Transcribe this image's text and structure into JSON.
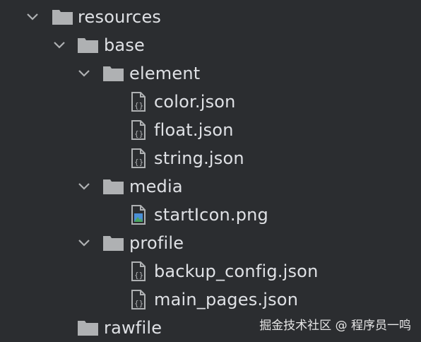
{
  "tree": {
    "items": [
      {
        "label": "resources",
        "type": "folder",
        "expanded": true,
        "icon": "folder-icon"
      },
      {
        "label": "base",
        "type": "folder",
        "expanded": true,
        "icon": "folder-icon"
      },
      {
        "label": "element",
        "type": "folder",
        "expanded": true,
        "icon": "folder-icon"
      },
      {
        "label": "color.json",
        "type": "file",
        "icon": "json-file-icon"
      },
      {
        "label": "float.json",
        "type": "file",
        "icon": "json-file-icon"
      },
      {
        "label": "string.json",
        "type": "file",
        "icon": "json-file-icon"
      },
      {
        "label": "media",
        "type": "folder",
        "expanded": true,
        "icon": "folder-icon"
      },
      {
        "label": "startIcon.png",
        "type": "file",
        "icon": "image-file-icon"
      },
      {
        "label": "profile",
        "type": "folder",
        "expanded": true,
        "icon": "folder-icon"
      },
      {
        "label": "backup_config.json",
        "type": "file",
        "icon": "json-file-icon"
      },
      {
        "label": "main_pages.json",
        "type": "file",
        "icon": "json-file-icon"
      },
      {
        "label": "rawfile",
        "type": "folder",
        "expanded": false,
        "icon": "folder-icon"
      }
    ]
  },
  "watermark": "掘金技术社区 @ 程序员一鸣",
  "colors": {
    "background": "#2b2d30",
    "text": "#dfe1e5",
    "icon": "#afb1b3",
    "image_icon_green": "#4aa55d",
    "image_icon_blue": "#4a8fd6"
  }
}
